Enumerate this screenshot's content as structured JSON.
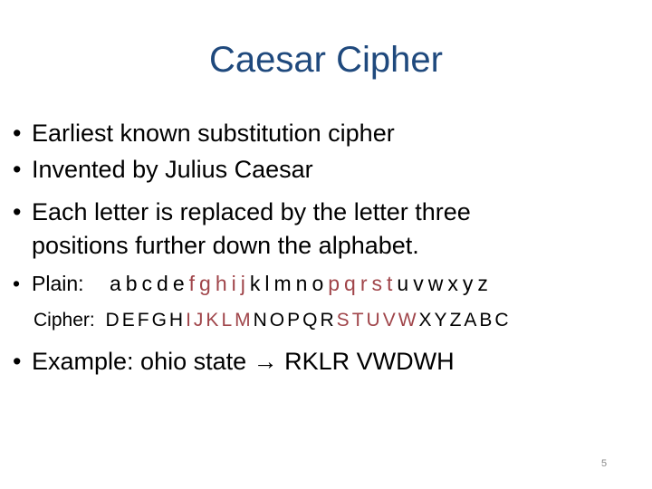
{
  "title": "Caesar Cipher",
  "bullets": [
    {
      "marker": "•",
      "text": "Earliest known substitution cipher"
    },
    {
      "marker": "•",
      "text": "Invented by Julius Caesar"
    },
    {
      "marker": "•",
      "text": "Each letter is replaced by the letter three"
    },
    {
      "marker": "",
      "text": "positions further down the alphabet."
    }
  ],
  "mapping": {
    "marker": "•",
    "plain_label": "Plain:",
    "cipher_label": "Cipher:",
    "plain": [
      "a",
      "b",
      "c",
      "d",
      "e",
      "f",
      "g",
      "h",
      "i",
      "j",
      "k",
      "l",
      "m",
      "n",
      "o",
      "p",
      "q",
      "r",
      "s",
      "t",
      "u",
      "v",
      "w",
      "x",
      "y",
      "z"
    ],
    "cipher": [
      "D",
      "E",
      "F",
      "G",
      "H",
      "I",
      "J",
      "K",
      "L",
      "M",
      "N",
      "O",
      "P",
      "Q",
      "R",
      "S",
      "T",
      "U",
      "V",
      "W",
      "X",
      "Y",
      "Z",
      "A",
      "B",
      "C"
    ],
    "highlighted_indices": [
      5,
      6,
      7,
      8,
      9,
      15,
      16,
      17,
      18,
      19
    ],
    "highlight_color": "#a0454a"
  },
  "example": {
    "marker": "•",
    "prefix": "Example: ohio state ",
    "arrow": "→",
    "result": " RKLR VWDWH"
  },
  "page_number": "5",
  "colors": {
    "title": "#1f497d",
    "text": "#000000",
    "highlight": "#a0454a"
  }
}
